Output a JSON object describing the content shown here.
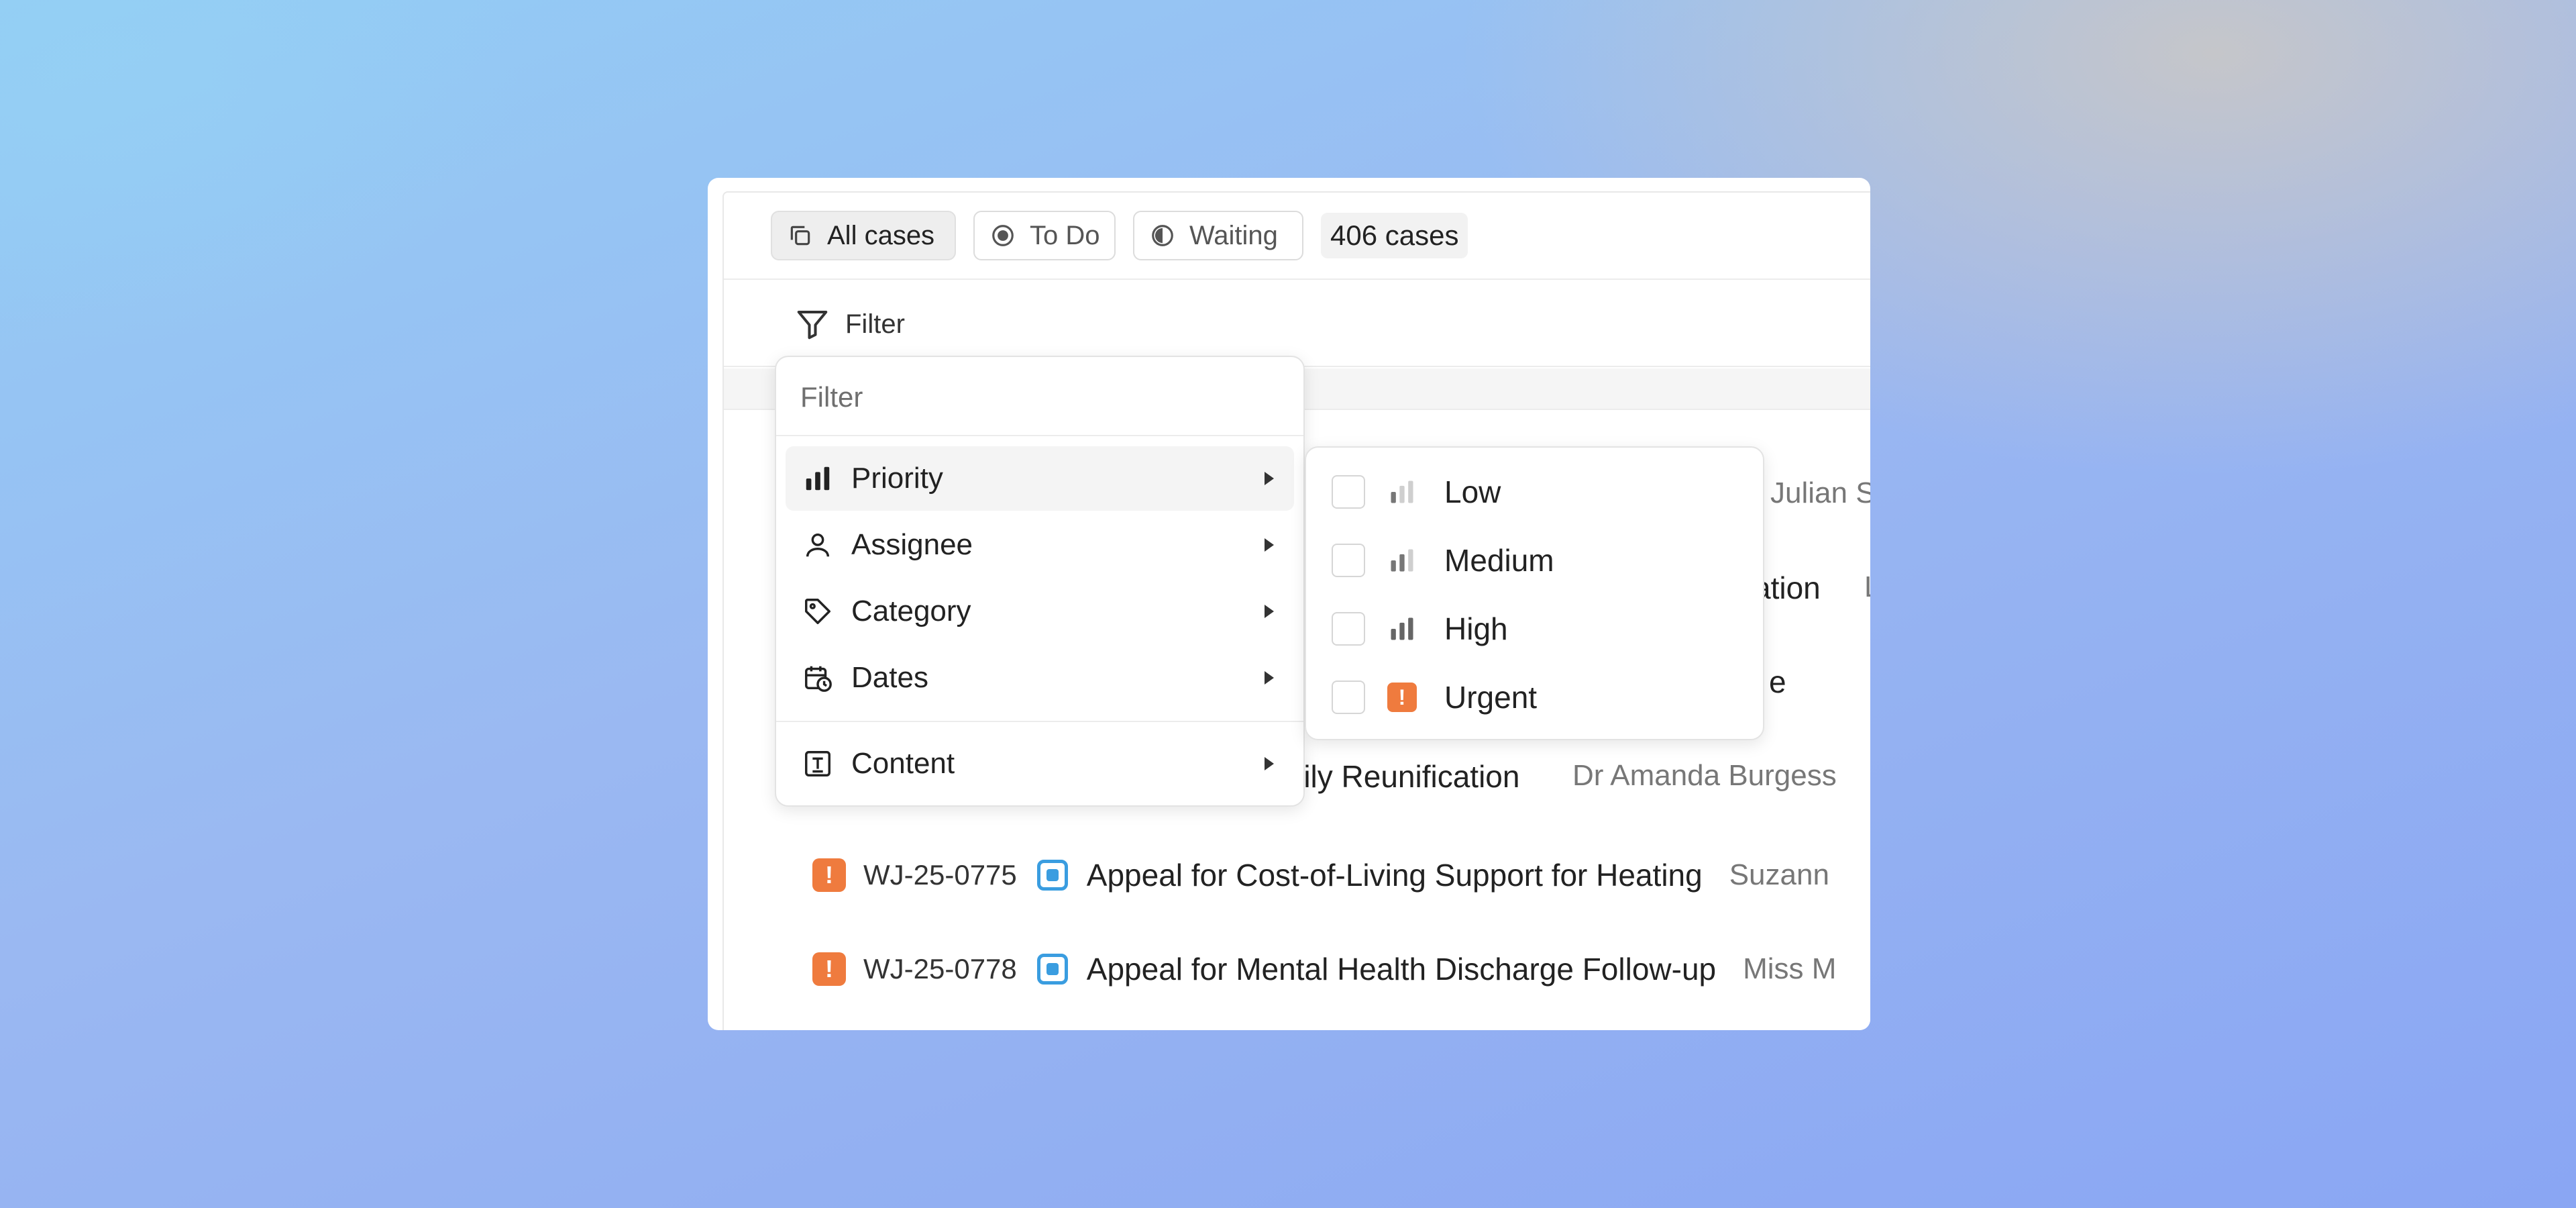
{
  "tabs": [
    {
      "label": "All cases",
      "icon": "copy-icon",
      "active": true
    },
    {
      "label": "To Do",
      "icon": "circle-dot-icon",
      "active": false
    },
    {
      "label": "Waiting",
      "icon": "half-circle-icon",
      "active": false
    }
  ],
  "case_count": "406 cases",
  "filter_label": "Filter",
  "filter_menu": {
    "search_placeholder": "Filter",
    "items": [
      {
        "label": "Priority",
        "icon": "bar-chart-icon"
      },
      {
        "label": "Assignee",
        "icon": "person-icon"
      },
      {
        "label": "Category",
        "icon": "tag-icon"
      },
      {
        "label": "Dates",
        "icon": "calendar-clock-icon"
      },
      {
        "label": "Content",
        "icon": "text-box-icon"
      }
    ]
  },
  "priority_submenu": {
    "options": [
      {
        "label": "Low",
        "icon": "priority-low-icon",
        "checked": false
      },
      {
        "label": "Medium",
        "icon": "priority-medium-icon",
        "checked": false
      },
      {
        "label": "High",
        "icon": "priority-high-icon",
        "checked": false
      },
      {
        "label": "Urgent",
        "icon": "priority-urgent-icon",
        "checked": false
      }
    ]
  },
  "partial_rows": {
    "r1_assignee": "Julian S",
    "r2_title": "ation",
    "r2_assignee": "L",
    "r3_title": "e",
    "r4_title": "mily Reunification",
    "r4_assignee": "Dr Amanda Burgess"
  },
  "rows": [
    {
      "priority_symbol": "!",
      "id": "WJ-25-0775",
      "title": "Appeal for Cost-of-Living Support for Heating",
      "assignee": "Suzann"
    },
    {
      "priority_symbol": "!",
      "id": "WJ-25-0778",
      "title": "Appeal for Mental Health Discharge Follow-up",
      "assignee": "Miss M"
    }
  ],
  "colors": {
    "accent_urgent": "#ef7b3e",
    "status_blue": "#3a9de0"
  }
}
